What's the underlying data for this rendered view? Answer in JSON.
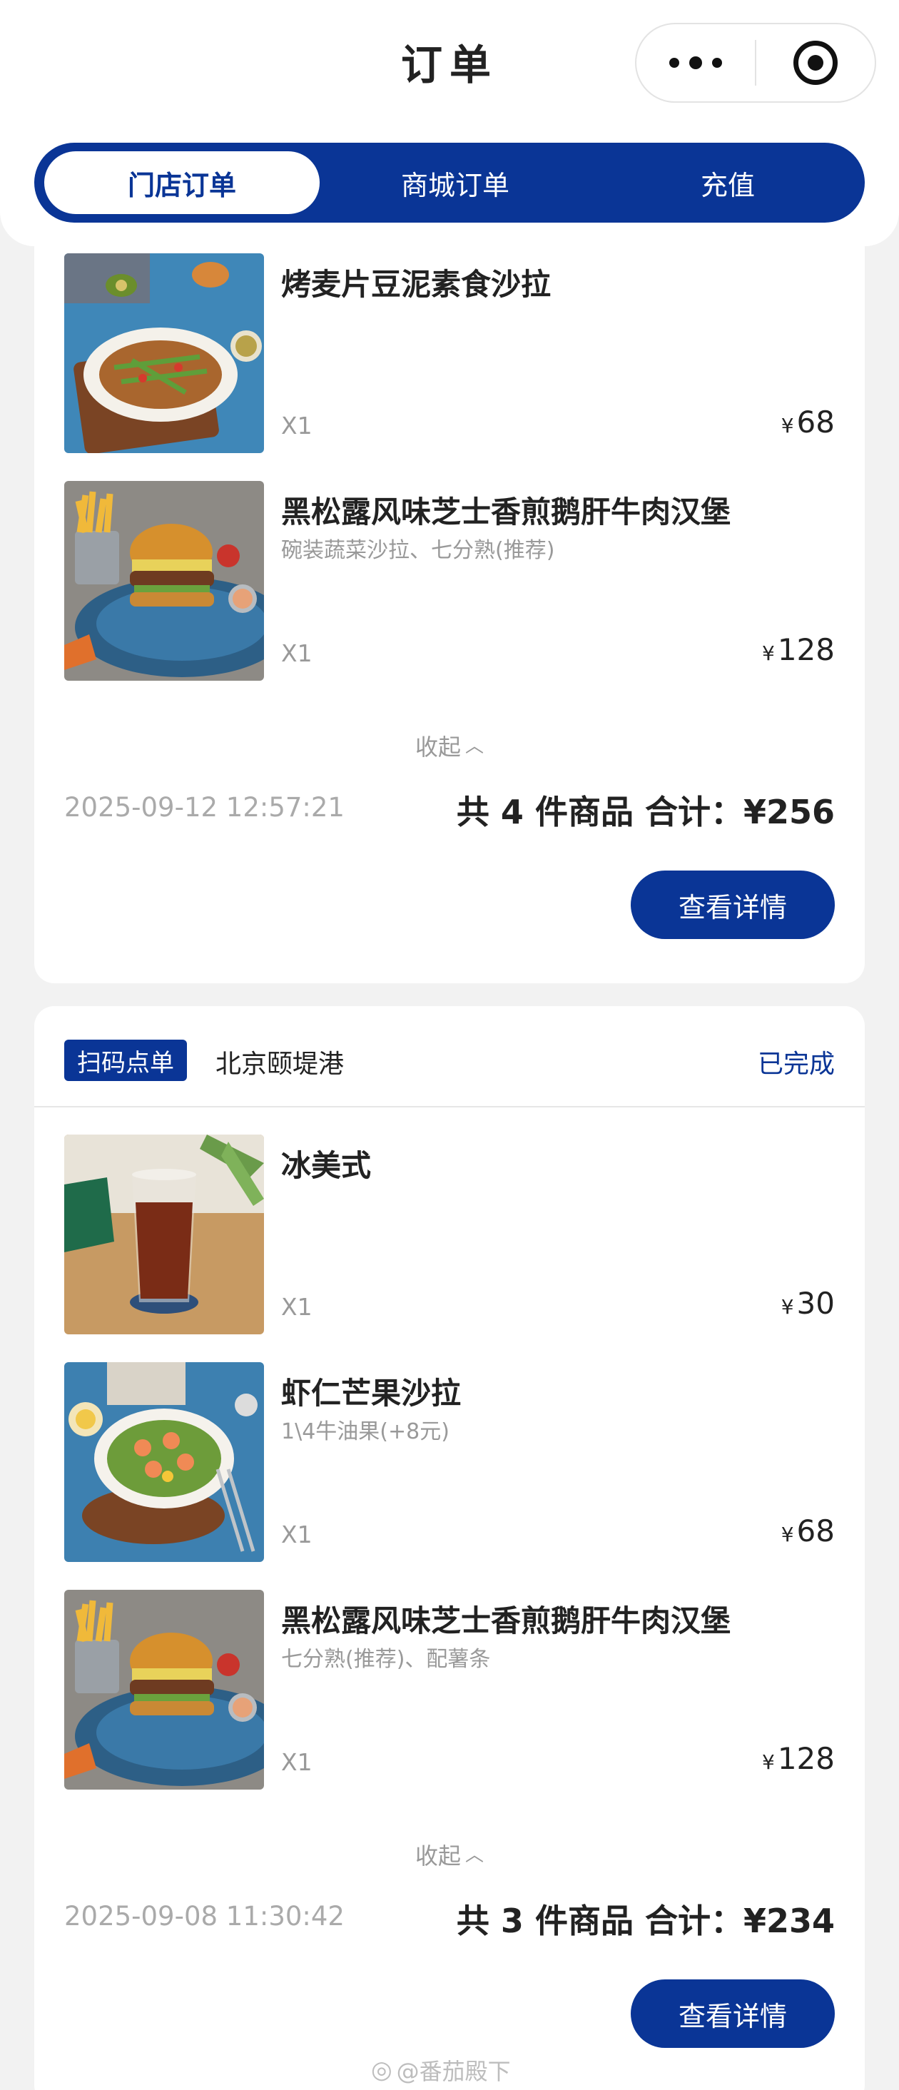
{
  "header": {
    "title": "订单",
    "tabs": [
      {
        "label": "门店订单",
        "active": true
      },
      {
        "label": "商城订单",
        "active": false
      },
      {
        "label": "充值",
        "active": false
      }
    ]
  },
  "accent_color": "#0a3596",
  "orders": [
    {
      "items": [
        {
          "name": "烤麦片豆泥素食沙拉",
          "spec": "",
          "qty": "X1",
          "currency": "¥",
          "price": "68",
          "image": "salad-image"
        },
        {
          "name": "黑松露风味芝士香煎鹅肝牛肉汉堡",
          "spec": "碗装蔬菜沙拉、七分熟(推荐)",
          "qty": "X1",
          "currency": "¥",
          "price": "128",
          "image": "burger-image"
        }
      ],
      "collapse_label": "收起",
      "time": "2025-09-12 12:57:21",
      "summary": "共 4 件商品 合计：¥256",
      "detail_label": "查看详情"
    },
    {
      "store_badge": "扫码点单",
      "store_name": "北京颐堤港",
      "status": "已完成",
      "items": [
        {
          "name": "冰美式",
          "spec": "",
          "qty": "X1",
          "currency": "¥",
          "price": "30",
          "image": "iced-americano-image"
        },
        {
          "name": "虾仁芒果沙拉",
          "spec": "1\\4牛油果(+8元)",
          "qty": "X1",
          "currency": "¥",
          "price": "68",
          "image": "shrimp-salad-image"
        },
        {
          "name": "黑松露风味芝士香煎鹅肝牛肉汉堡",
          "spec": "七分熟(推荐)、配薯条",
          "qty": "X1",
          "currency": "¥",
          "price": "128",
          "image": "burger-image"
        }
      ],
      "collapse_label": "收起",
      "time": "2025-09-08 11:30:42",
      "summary": "共 3 件商品 合计：¥234",
      "detail_label": "查看详情"
    }
  ],
  "watermark": "@番茄殿下"
}
